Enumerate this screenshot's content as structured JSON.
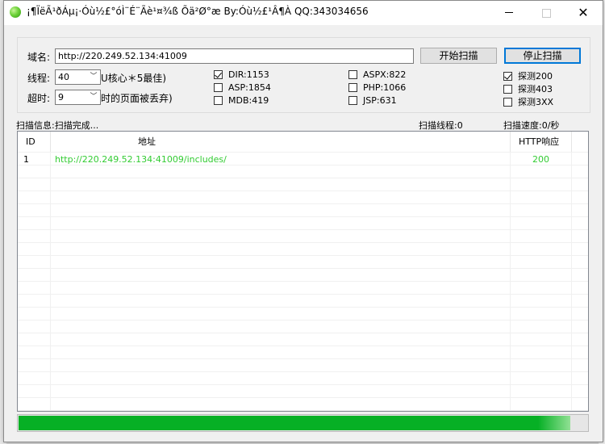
{
  "window": {
    "title": "¡¶ÏëÃ¹ðÁµ¡·Óù½£°óÌ¨É¨Ãè¹¤¾ß Õä²Ø°æ By:Óù½£¹Â¶À QQ:343034656",
    "minimize_glyph": "",
    "maximize_glyph": "",
    "close_glyph": "✕"
  },
  "form": {
    "domain_label": "域名:",
    "domain_value": "http://220.249.52.134:41009",
    "start_button": "开始扫描",
    "stop_button": "停止扫描",
    "threads_label": "线程:",
    "threads_value": "40",
    "threads_hint": "U核心＊5最佳)",
    "timeout_label": "超时:",
    "timeout_value": "9",
    "timeout_hint": "时的页面被丢弃)"
  },
  "checkboxes": [
    {
      "label": "DIR:1153",
      "checked": true
    },
    {
      "label": "ASP:1854",
      "checked": false
    },
    {
      "label": "MDB:419",
      "checked": false
    },
    {
      "label": "ASPX:822",
      "checked": false
    },
    {
      "label": "PHP:1066",
      "checked": false
    },
    {
      "label": "JSP:631",
      "checked": false
    },
    {
      "label": "探测200",
      "checked": true
    },
    {
      "label": "探测403",
      "checked": false
    },
    {
      "label": "探测3XX",
      "checked": false
    }
  ],
  "status": {
    "info": "扫描信息:扫描完成...",
    "threads": "扫描线程:0",
    "speed": "扫描速度:0/秒"
  },
  "table": {
    "columns": [
      "ID",
      "地址",
      "HTTP响应"
    ],
    "rows": [
      {
        "id": "1",
        "url": "http://220.249.52.134:41009/includes/",
        "code": "200"
      }
    ]
  },
  "progress": {
    "value": 0.97
  },
  "colors": {
    "link_green": "#33cc33",
    "progress_green": "#06b025"
  }
}
